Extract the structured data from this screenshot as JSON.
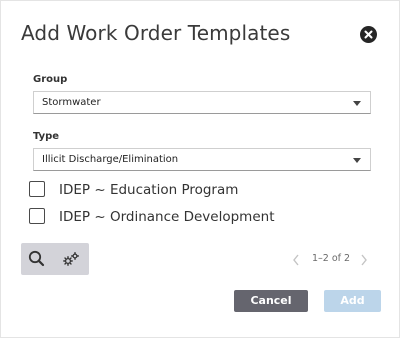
{
  "dialog": {
    "title": "Add Work Order Templates"
  },
  "group": {
    "label": "Group",
    "value": "Stormwater"
  },
  "type": {
    "label": "Type",
    "value": "Illicit Discharge/Elimination"
  },
  "templates": [
    {
      "label": "IDEP ~ Education Program",
      "checked": false
    },
    {
      "label": "IDEP ~ Ordinance Development",
      "checked": false
    }
  ],
  "pager": {
    "text": "1–2 of 2"
  },
  "buttons": {
    "cancel": "Cancel",
    "add": "Add"
  },
  "icons": {
    "close": "close-icon",
    "search": "search-icon",
    "settings": "gears-icon",
    "prev": "chevron-left-icon",
    "next": "chevron-right-icon"
  },
  "colors": {
    "cancel_bg": "#65656e",
    "add_bg_disabled": "#bcd5ea",
    "toolbar_bg": "#d3d3d9"
  }
}
